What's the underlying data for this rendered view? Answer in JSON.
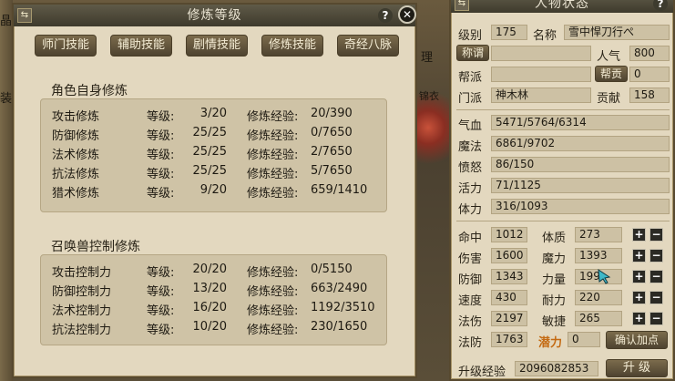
{
  "left_panel": {
    "title": "修炼等级",
    "tabs": [
      "师门技能",
      "辅助技能",
      "剧情技能",
      "修炼技能",
      "奇经八脉"
    ],
    "self_section": {
      "title": "角色自身修炼",
      "rows": [
        {
          "name": "攻击修炼",
          "level_label": "等级:",
          "level": "3/20",
          "exp_label": "修炼经验:",
          "exp": "20/390"
        },
        {
          "name": "防御修炼",
          "level_label": "等级:",
          "level": "25/25",
          "exp_label": "修炼经验:",
          "exp": "0/7650"
        },
        {
          "name": "法术修炼",
          "level_label": "等级:",
          "level": "25/25",
          "exp_label": "修炼经验:",
          "exp": "2/7650"
        },
        {
          "name": "抗法修炼",
          "level_label": "等级:",
          "level": "25/25",
          "exp_label": "修炼经验:",
          "exp": "5/7650"
        },
        {
          "name": "猎术修炼",
          "level_label": "等级:",
          "level": "9/20",
          "exp_label": "修炼经验:",
          "exp": "659/1410"
        }
      ]
    },
    "pet_section": {
      "title": "召唤兽控制修炼",
      "rows": [
        {
          "name": "攻击控制力",
          "level_label": "等级:",
          "level": "20/20",
          "exp_label": "修炼经验:",
          "exp": "0/5150"
        },
        {
          "name": "防御控制力",
          "level_label": "等级:",
          "level": "13/20",
          "exp_label": "修炼经验:",
          "exp": "663/2490"
        },
        {
          "name": "法术控制力",
          "level_label": "等级:",
          "level": "16/20",
          "exp_label": "修炼经验:",
          "exp": "1192/3510"
        },
        {
          "name": "抗法控制力",
          "level_label": "等级:",
          "level": "10/20",
          "exp_label": "修炼经验:",
          "exp": "230/1650"
        }
      ]
    }
  },
  "right_panel": {
    "title": "人物状态",
    "level_label": "级别",
    "level": "175",
    "name_label": "名称",
    "name": "雪中悍刀行ぺ",
    "title_btn": "称谓",
    "popularity_label": "人气",
    "popularity": "800",
    "faction_label": "帮派",
    "contrib_btn": "帮贡",
    "contrib": "0",
    "school_label": "门派",
    "school": "神木林",
    "merit_label": "贡献",
    "merit": "158",
    "hp_label": "气血",
    "hp": "5471/5764/6314",
    "mp_label": "魔法",
    "mp": "6861/9702",
    "anger_label": "愤怒",
    "anger": "86/150",
    "vitality_label": "活力",
    "vitality": "71/1125",
    "stamina_label": "体力",
    "stamina": "316/1093",
    "combat": [
      {
        "label": "命中",
        "value": "1012"
      },
      {
        "label": "伤害",
        "value": "1600"
      },
      {
        "label": "防御",
        "value": "1343"
      },
      {
        "label": "速度",
        "value": "430"
      },
      {
        "label": "法伤",
        "value": "2197"
      },
      {
        "label": "法防",
        "value": "1763"
      }
    ],
    "attrs": [
      {
        "label": "体质",
        "value": "273"
      },
      {
        "label": "魔力",
        "value": "1393"
      },
      {
        "label": "力量",
        "value": "199"
      },
      {
        "label": "耐力",
        "value": "220"
      },
      {
        "label": "敏捷",
        "value": "265"
      }
    ],
    "potential_label": "潜力",
    "potential": "0",
    "confirm_btn": "确认加点",
    "upgrade_exp_label": "升级经验",
    "upgrade_exp": "2096082853",
    "upgrade_btn": "升 级",
    "plus": "+",
    "minus": "−"
  },
  "background": {
    "text_a": "晶",
    "text_b": "装",
    "text_c": "理",
    "text_d": "锦衣"
  },
  "icons": {
    "help": "?",
    "close": "✕",
    "menu": "⇆"
  }
}
